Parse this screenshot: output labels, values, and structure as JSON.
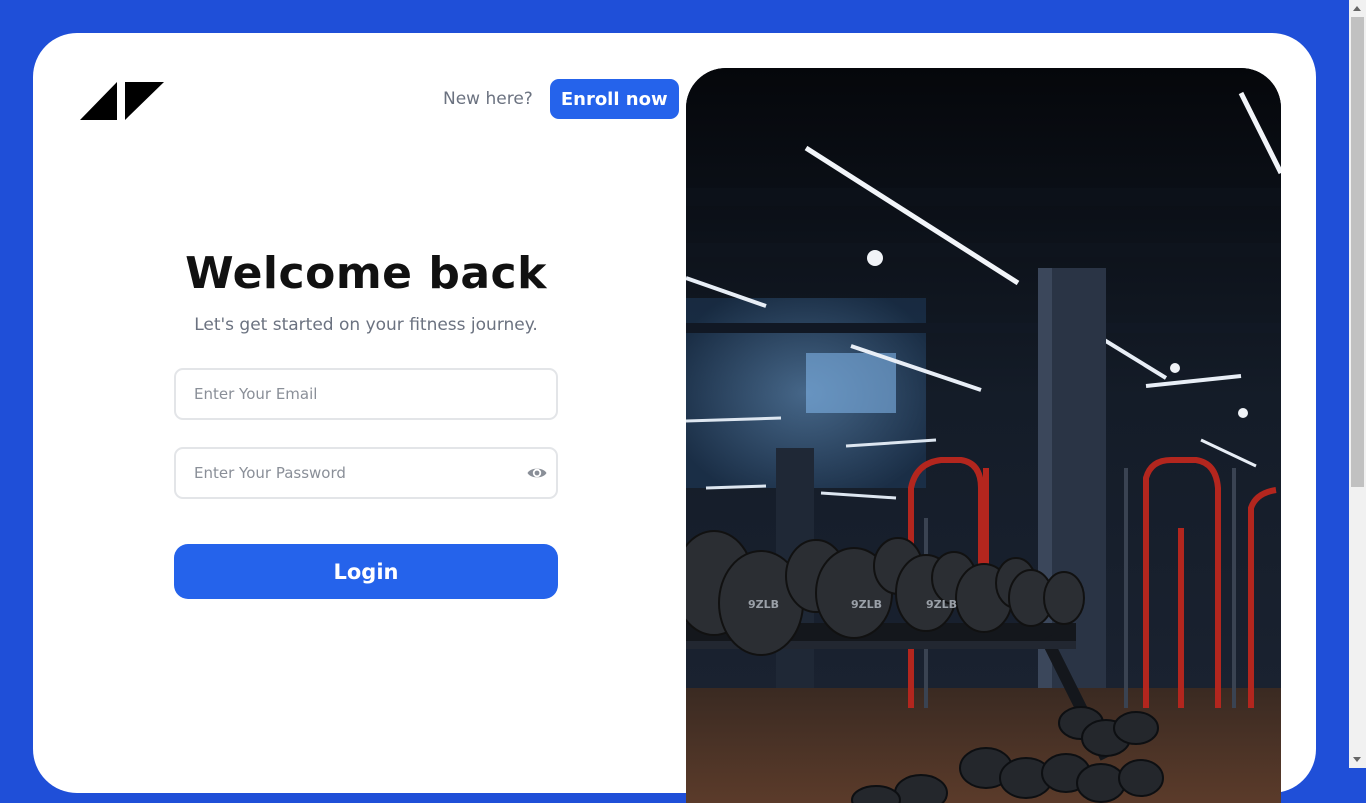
{
  "header": {
    "new_here": "New here?",
    "enroll_label": "Enroll now"
  },
  "logo": {
    "icon": "brand-logo-icon"
  },
  "main": {
    "title": "Welcome back",
    "subtitle": "Let's get started on your fitness journey."
  },
  "form": {
    "email_placeholder": "Enter Your Email",
    "password_placeholder": "Enter Your Password",
    "login_label": "Login",
    "eye_icon": "eye-icon"
  },
  "colors": {
    "background": "#1f4fd8",
    "accent": "#2563eb",
    "heading": "#111111",
    "muted": "#6b7280"
  }
}
